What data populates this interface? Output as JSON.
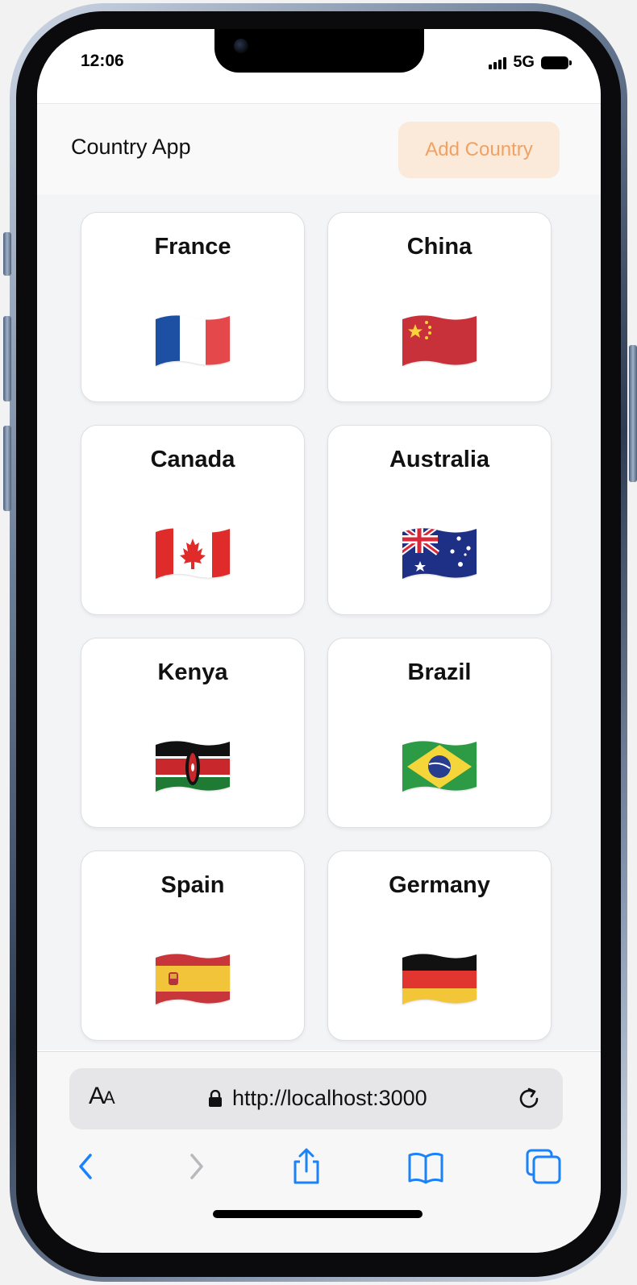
{
  "status_bar": {
    "time": "12:06",
    "network": "5G"
  },
  "header": {
    "title": "Country App",
    "add_button_label": "Add Country"
  },
  "countries": [
    {
      "name": "France",
      "flag_icon": "france-flag-icon"
    },
    {
      "name": "China",
      "flag_icon": "china-flag-icon"
    },
    {
      "name": "Canada",
      "flag_icon": "canada-flag-icon"
    },
    {
      "name": "Australia",
      "flag_icon": "australia-flag-icon"
    },
    {
      "name": "Kenya",
      "flag_icon": "kenya-flag-icon"
    },
    {
      "name": "Brazil",
      "flag_icon": "brazil-flag-icon"
    },
    {
      "name": "Spain",
      "flag_icon": "spain-flag-icon"
    },
    {
      "name": "Germany",
      "flag_icon": "germany-flag-icon"
    }
  ],
  "browser": {
    "text_size_label": "AA",
    "url": "http://localhost:3000"
  },
  "colors": {
    "accent_button_bg": "#fbe9d9",
    "accent_button_text": "#f0a264",
    "safari_blue": "#1a82fb",
    "content_bg": "#f3f4f6"
  }
}
